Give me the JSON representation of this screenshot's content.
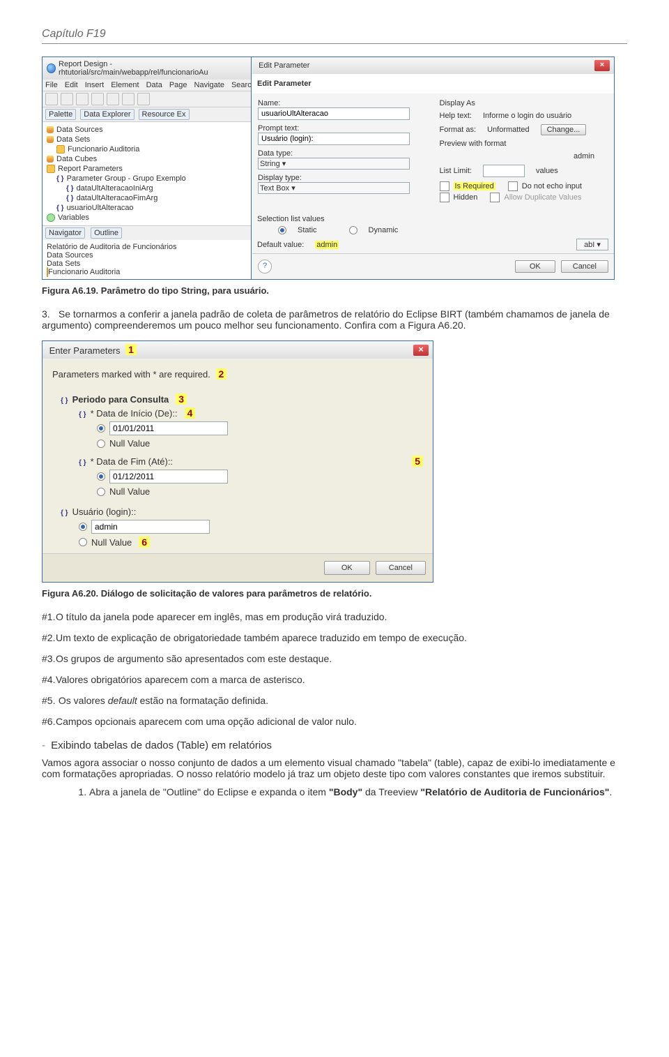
{
  "pageHeader": "Capítulo F19",
  "eclipse": {
    "title": "Report Design - rhtutorial/src/main/webapp/rel/funcionarioAu",
    "menu": [
      "File",
      "Edit",
      "Insert",
      "Element",
      "Data",
      "Page",
      "Navigate",
      "Search"
    ],
    "tabs": [
      "Palette",
      "Data Explorer",
      "Resource Ex"
    ],
    "tree": {
      "dataSources": "Data Sources",
      "dataSets": "Data Sets",
      "funcionarioAuditoria": "Funcionario Auditoria",
      "dataCubes": "Data Cubes",
      "reportParameters": "Report Parameters",
      "paramGroup": "Parameter Group - Grupo Exemplo",
      "paramIni": "dataUltAlteracaoIniArg",
      "paramFim": "dataUltAlteracaoFimArg",
      "paramUsuario": "usuarioUltAlteracao",
      "variables": "Variables"
    },
    "outlineTabs": [
      "Navigator",
      "Outline"
    ],
    "outline": {
      "relTitle": "Relatório de Auditoria de Funcionários",
      "dataSources": "Data Sources",
      "dataSets": "Data Sets",
      "funcionarioAuditoria": "Funcionario Auditoria"
    }
  },
  "editParam": {
    "winTitle": "Edit Parameter",
    "header": "Edit Parameter",
    "nameLabel": "Name:",
    "nameValue": "usuarioUltAlteracao",
    "promptLabel": "Prompt text:",
    "promptValue": "Usuário (login):",
    "dataTypeLabel": "Data type:",
    "dataTypeValue": "String",
    "displayTypeLabel": "Display type:",
    "displayTypeValue": "Text Box",
    "displayAs": "Display As",
    "helpTextLabel": "Help text:",
    "helpTextValue": "Informe o login do usuário",
    "formatAsLabel": "Format as:",
    "formatAsValue": "Unformatted",
    "change": "Change...",
    "previewLabel": "Preview with format",
    "previewValue": "admin",
    "listLimitLabel": "List Limit:",
    "listLimitAfter": "values",
    "isRequired": "Is Required",
    "noEcho": "Do not echo input",
    "hidden": "Hidden",
    "allowDup": "Allow Duplicate Values",
    "selectionLabel": "Selection list values",
    "static": "Static",
    "dynamic": "Dynamic",
    "defaultLabel": "Default value:",
    "defaultValue": "admin",
    "abI": "abI",
    "ok": "OK",
    "cancel": "Cancel"
  },
  "caption1": "Figura A6.19. Parâmetro do tipo String, para usuário.",
  "para3": {
    "num": "3.",
    "text": "Se tornarmos a conferir a janela padrão de coleta de parâmetros de relatório do Eclipse BIRT (também chamamos de janela de argumento) compreenderemos um pouco melhor seu funcionamento. Confira com a Figura A6.20."
  },
  "enterParams": {
    "title": "Enter Parameters",
    "required": "Parameters marked with * are required.",
    "groupPeriodo": "Periodo para Consulta",
    "dataInicio": "Data de Início (De)::",
    "dataInicioVal": "01/01/2011",
    "nullValue": "Null Value",
    "dataFim": "Data de Fim (Até)::",
    "dataFimVal": "01/12/2011",
    "usuario": "Usuário (login)::",
    "usuarioVal": "admin",
    "ok": "OK",
    "cancel": "Cancel",
    "markers": {
      "1": "1",
      "2": "2",
      "3": "3",
      "4": "4",
      "5": "5",
      "6": "6"
    }
  },
  "caption2": "Figura A6.20. Diálogo de solicitação de valores para parâmetros de relatório.",
  "hashList": {
    "h1": {
      "tag": "#1.",
      "txt": "O título da janela pode aparecer em inglês, mas em produção virá traduzido."
    },
    "h2": {
      "tag": "#2.",
      "txt": "Um texto de explicação de obrigatoriedade também aparece traduzido em tempo de execução."
    },
    "h3": {
      "tag": "#3.",
      "txt": "Os grupos de argumento são apresentados com este destaque."
    },
    "h4": {
      "tag": "#4.",
      "txt": "Valores obrigatórios aparecem com a marca de asterisco."
    },
    "h5": {
      "tag": "#5.",
      "txt_before": "Os valores ",
      "txt_em": "default",
      "txt_after": " estão na formatação definida."
    },
    "h6": {
      "tag": "#6.",
      "txt": "Campos opcionais aparecem com uma opção adicional de valor nulo."
    }
  },
  "section": {
    "dash": "-",
    "title": "Exibindo tabelas de dados (Table) em relatórios",
    "para": "Vamos agora associar o nosso conjunto de dados a um elemento visual chamado \"tabela\" (table), capaz de exibi-lo imediatamente e com formatações apropriadas. O nosso relatório modelo já traz um objeto deste tipo com valores constantes que iremos substituir."
  },
  "finalList": {
    "item1": {
      "pre": "Abra a janela de \"Outline\" do Eclipse e expanda o item ",
      "b1": "\"Body\"",
      "mid": " da Treeview ",
      "b2": "\"Relatório de Auditoria de Funcionários\"",
      "end": "."
    }
  }
}
